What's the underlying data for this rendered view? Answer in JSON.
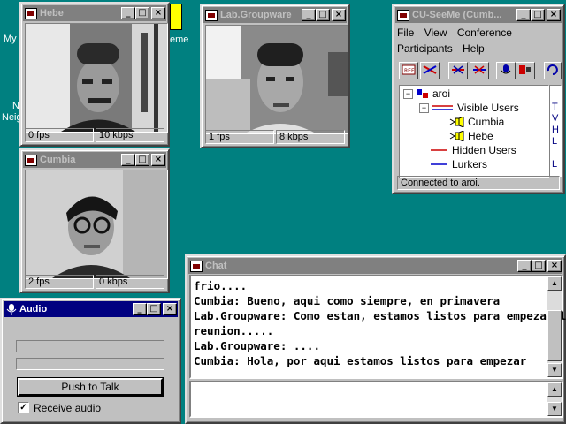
{
  "desktop": {
    "labels": [
      "My",
      "N",
      "Neig",
      "eme"
    ]
  },
  "windows": {
    "hebe": {
      "title": "Hebe",
      "fps": "0 fps",
      "kbps": "10 kbps"
    },
    "groupware": {
      "title": "Lab.Groupware",
      "fps": "1 fps",
      "kbps": "8 kbps"
    },
    "cumbia": {
      "title": "Cumbia",
      "fps": "2 fps",
      "kbps": "0 kbps"
    },
    "cuseeme": {
      "title": "CU-SeeMe (Cumb...",
      "menu": [
        "File",
        "View",
        "Conference",
        "Participants",
        "Help"
      ],
      "tree": {
        "root": "aroi",
        "visible": "Visible Users",
        "users": [
          "Cumbia",
          "Hebe"
        ],
        "hidden": "Hidden Users",
        "lurkers": "Lurkers"
      },
      "status": "Connected to aroi.",
      "side_letters": [
        "T",
        "V",
        "H",
        "L",
        "L"
      ]
    },
    "chat": {
      "title": "Chat",
      "lines": [
        "frio....",
        "Cumbia: Bueno, aqui como siempre, en primavera",
        "Lab.Groupware: Como estan, estamos listos para empezar la",
        "reunion.....",
        "Lab.Groupware: ....",
        "Cumbia: Hola, por aqui estamos listos para empezar"
      ],
      "input_value": ""
    },
    "audio": {
      "title": "Audio",
      "push_label": "Push to Talk",
      "receive_label": "Receive audio",
      "receive_checked": true
    }
  },
  "icons": {
    "minimize": "_",
    "maximize": "□",
    "close": "×",
    "check": "✓"
  }
}
